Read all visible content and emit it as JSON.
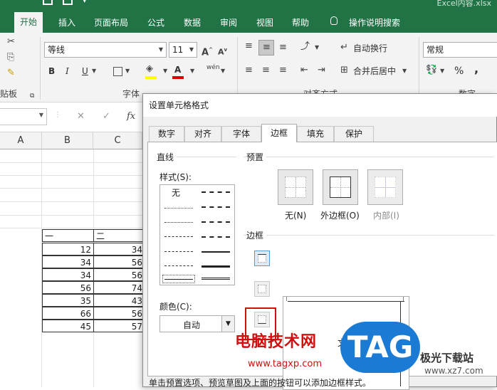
{
  "window": {
    "title": "Excel内容.xlsx"
  },
  "ribbon_tabs": [
    "开始",
    "插入",
    "页面布局",
    "公式",
    "数据",
    "审阅",
    "视图",
    "帮助",
    "操作说明搜索"
  ],
  "ribbon": {
    "font_name": "等线",
    "font_size": "11",
    "bold": "B",
    "italic": "I",
    "underline": "U",
    "wrap_text": "自动换行",
    "merge_center": "合并后居中",
    "number_format": "常规",
    "group_clipboard": "贴板",
    "group_font": "字体",
    "group_alignment": "对齐方式",
    "group_number": "数字",
    "percent": "%",
    "comma": ","
  },
  "formula_bar": {
    "fx": "fx"
  },
  "grid": {
    "columns": [
      "A",
      "B",
      "C"
    ],
    "headers": [
      "一",
      "二"
    ],
    "col_b": [
      "12",
      "34",
      "34",
      "56",
      "35",
      "66",
      "45"
    ],
    "col_c": [
      "34",
      "56",
      "56",
      "74",
      "43",
      "56",
      "57"
    ]
  },
  "dialog": {
    "title": "设置单元格格式",
    "tabs": [
      "数字",
      "对齐",
      "字体",
      "边框",
      "填充",
      "保护"
    ],
    "active_tab": "边框",
    "line_group": "直线",
    "style_label": "样式(S):",
    "style_none": "无",
    "color_label": "颜色(C):",
    "color_value": "自动",
    "preset_group": "预置",
    "preset_none": "无(N)",
    "preset_outline": "外边框(O)",
    "preset_inside": "内部(I)",
    "border_group": "边框",
    "preview_text": "文本",
    "hint": "单击预置选项、预览草图及上面的按钮可以添加边框样式。"
  },
  "watermark": {
    "brand": "电脑技术网",
    "url": "www.tagxp.com",
    "tag": "TAG",
    "site": "极光下载站",
    "site_url": "www.xz7.com"
  }
}
